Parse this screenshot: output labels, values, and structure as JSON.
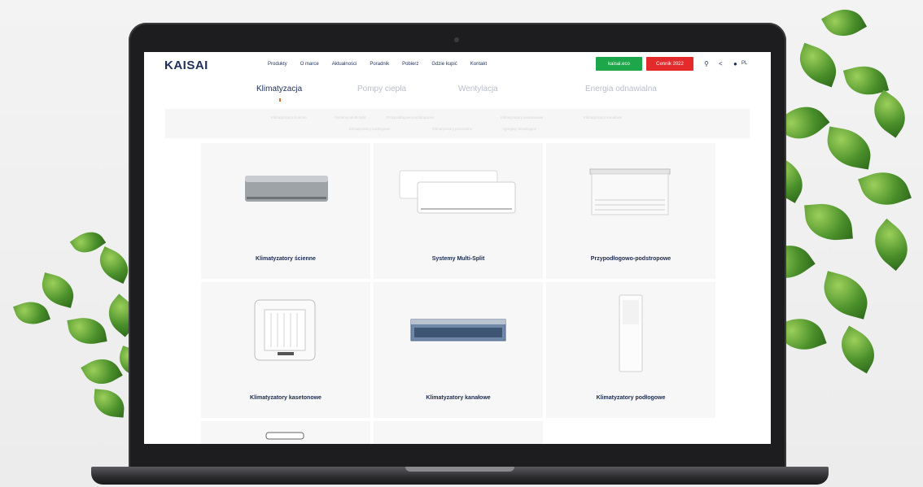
{
  "site": {
    "logo": "KAISAI",
    "nav": [
      "Produkty",
      "O marce",
      "Aktualności",
      "Poradnik",
      "Pobierz",
      "Gdzie kupić",
      "Kontakt"
    ],
    "btn_green": "kaisai.eco",
    "btn_red": "Cennik 2022",
    "lang": "PL"
  },
  "categories": [
    "Klimatyzacja",
    "Pompy ciepła",
    "Wentylacja",
    "Energia odnawialna"
  ],
  "active_category": 0,
  "subcategories": [
    "Klimatyzatory ścienne",
    "Systemy Multi-Split",
    "Przypodłogowo-podstropowe",
    "Klimatyzatory kasetonowe",
    "Klimatyzatory kanałowe",
    "Klimatyzatory podłogowe",
    "Klimatyzatory przenośne",
    "Agregaty skraplające"
  ],
  "products": [
    {
      "name": "Klimatyzatory ścienne",
      "icon": "wall-ac"
    },
    {
      "name": "Systemy Multi-Split",
      "icon": "multi-split"
    },
    {
      "name": "Przypodłogowo-podstropowe",
      "icon": "floor-ceiling"
    },
    {
      "name": "Klimatyzatory kasetonowe",
      "icon": "cassette"
    },
    {
      "name": "Klimatyzatory kanałowe",
      "icon": "duct"
    },
    {
      "name": "Klimatyzatory podłogowe",
      "icon": "floor-standing"
    }
  ],
  "colors": {
    "brand_navy": "#1f2f5c",
    "green": "#1ea64b",
    "red": "#e42a2a",
    "accent_orange": "#e46a26"
  }
}
